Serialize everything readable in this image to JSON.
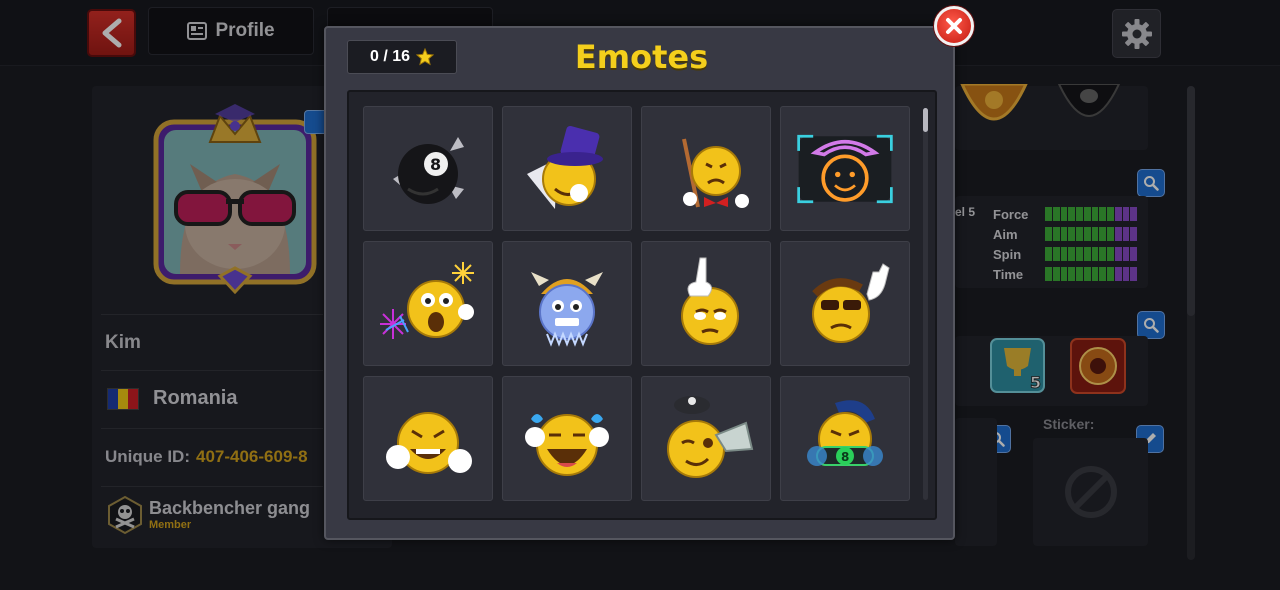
{
  "topbar": {
    "profile_tab": "Profile",
    "icons": [
      "back-arrow-icon",
      "profile-card-icon",
      "gear-icon"
    ]
  },
  "profile": {
    "name": "Kim",
    "country": "Romania",
    "unique_id_label": "Unique ID:",
    "unique_id_value": "407-406-609-8",
    "club_name": "Backbencher gang",
    "club_role": "Member"
  },
  "stats": {
    "level_text": "el 5",
    "labels": [
      "Force",
      "Aim",
      "Spin",
      "Time"
    ]
  },
  "sticker_label": "Sticker:",
  "modal": {
    "title": "Emotes",
    "counter": "0 / 16",
    "emotes": [
      "eight-ball-shuriken-emote",
      "top-hat-magician-emote",
      "cue-bowtie-emote",
      "neon-cowboy-emote",
      "fireworks-shocked-emote",
      "frozen-viking-emote",
      "thinking-finger-emote",
      "cool-sunglasses-wave-emote",
      "laughing-hands-emote",
      "crying-laughing-emote",
      "winking-cap-emote",
      "masked-ninja-emote"
    ]
  },
  "colors": {
    "accent_gold": "#f4cf1c",
    "id_gold": "#d4a41c",
    "back_red": "#c9271f",
    "close_red": "#d92a1c",
    "stat_green": "#3fae3a",
    "stat_purple": "#8a4cc9",
    "action_blue": "#1f6fd1"
  }
}
